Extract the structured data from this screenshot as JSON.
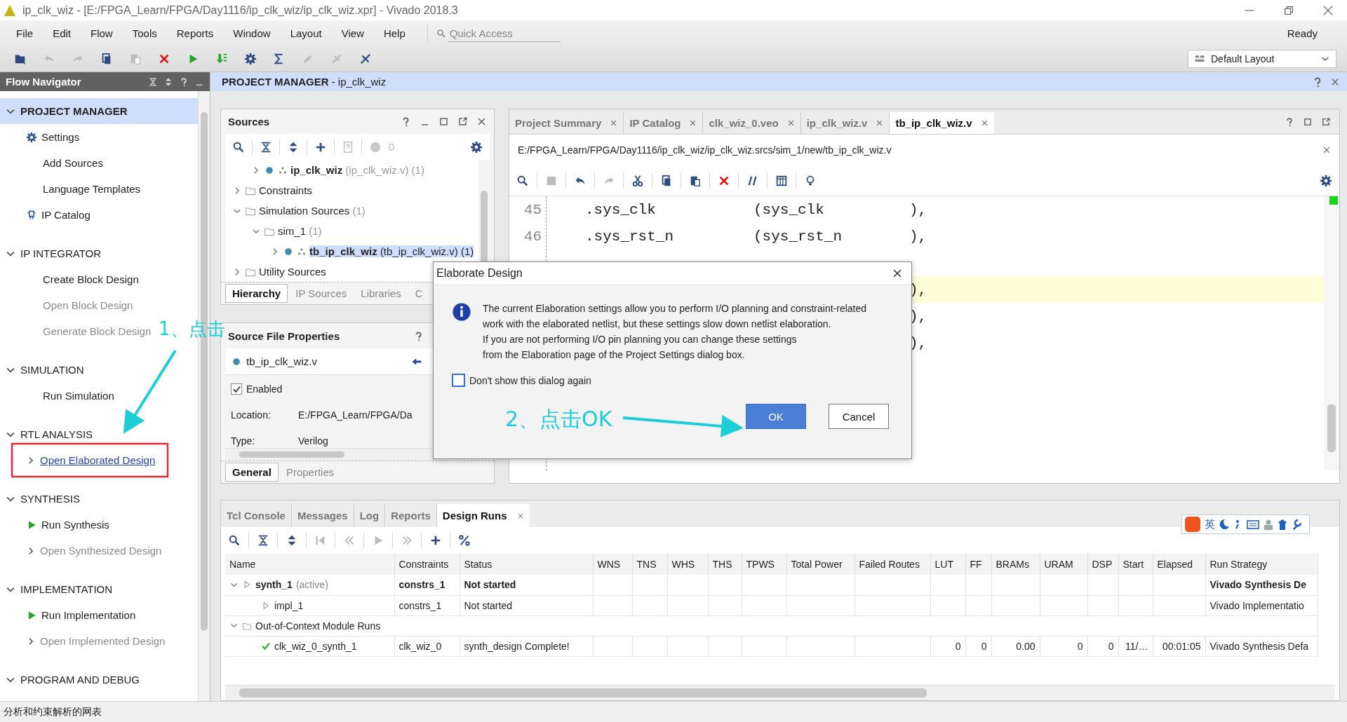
{
  "window": {
    "title": "ip_clk_wiz - [E:/FPGA_Learn/FPGA/Day1116/ip_clk_wiz/ip_clk_wiz.xpr] - Vivado 2018.3"
  },
  "menu": [
    "File",
    "Edit",
    "Flow",
    "Tools",
    "Reports",
    "Window",
    "Layout",
    "View",
    "Help"
  ],
  "quick_access": {
    "placeholder": "Quick Access"
  },
  "status": "Ready",
  "toolbar": [
    {
      "kind": "open",
      "disabled": false
    },
    {
      "kind": "undo",
      "disabled": true
    },
    {
      "kind": "redo",
      "disabled": true
    },
    {
      "kind": "copy",
      "disabled": false
    },
    {
      "kind": "paste",
      "disabled": true
    },
    {
      "kind": "delete",
      "disabled": false
    },
    {
      "kind": "run",
      "disabled": false
    },
    {
      "kind": "bitstream",
      "disabled": false
    },
    {
      "kind": "settings",
      "disabled": false
    },
    {
      "kind": "sigma",
      "disabled": false
    },
    {
      "kind": "pencil",
      "disabled": true
    },
    {
      "kind": "link",
      "disabled": true
    },
    {
      "kind": "tool",
      "disabled": false
    }
  ],
  "layout_selector": {
    "value": "Default Layout"
  },
  "flow_navigator": {
    "title": "Flow Navigator",
    "sections": [
      {
        "title": "PROJECT MANAGER",
        "expanded": true,
        "selected": true,
        "items": [
          {
            "label": "Settings",
            "kind": "settings",
            "disabled": false,
            "hovered": false
          },
          {
            "label": "Add Sources",
            "kind": "plain",
            "disabled": false,
            "hovered": false
          },
          {
            "label": "Language Templates",
            "kind": "plain",
            "disabled": false,
            "hovered": false
          },
          {
            "label": "IP Catalog",
            "kind": "ip",
            "disabled": false,
            "hovered": false
          }
        ]
      },
      {
        "title": "IP INTEGRATOR",
        "expanded": true,
        "selected": false,
        "items": [
          {
            "label": "Create Block Design",
            "kind": "plain",
            "disabled": false,
            "hovered": false
          },
          {
            "label": "Open Block Design",
            "kind": "plain",
            "disabled": true,
            "hovered": false
          },
          {
            "label": "Generate Block Design",
            "kind": "plain",
            "disabled": true,
            "hovered": false
          }
        ]
      },
      {
        "title": "SIMULATION",
        "expanded": true,
        "selected": false,
        "items": [
          {
            "label": "Run Simulation",
            "kind": "plain",
            "disabled": false,
            "hovered": false
          }
        ]
      },
      {
        "title": "RTL ANALYSIS",
        "expanded": true,
        "selected": false,
        "items": [
          {
            "label": "Open Elaborated Design",
            "kind": "expander",
            "disabled": false,
            "hovered": true
          }
        ]
      },
      {
        "title": "SYNTHESIS",
        "expanded": true,
        "selected": false,
        "items": [
          {
            "label": "Run Synthesis",
            "kind": "run",
            "disabled": false,
            "hovered": false
          },
          {
            "label": "Open Synthesized Design",
            "kind": "expander",
            "disabled": true,
            "hovered": false
          }
        ]
      },
      {
        "title": "IMPLEMENTATION",
        "expanded": true,
        "selected": false,
        "items": [
          {
            "label": "Run Implementation",
            "kind": "run",
            "disabled": false,
            "hovered": false
          },
          {
            "label": "Open Implemented Design",
            "kind": "expander",
            "disabled": true,
            "hovered": false
          }
        ]
      },
      {
        "title": "PROGRAM AND DEBUG",
        "expanded": true,
        "selected": false
      }
    ]
  },
  "project_header": "**PROJECT MANAGER** - ip_clk_wiz",
  "sources": {
    "title": "Sources",
    "warnings": "0",
    "tree": [
      {
        "children": [
          {
            "label": "ip_clk_wiz",
            "detail": "(ip_clk_wiz.v) (1)",
            "kind": "module",
            "expanded": false,
            "selected": false
          }
        ]
      },
      {
        "label": "Constraints",
        "kind": "folder",
        "expanded": false,
        "selected": false
      },
      {
        "label": "Simulation Sources",
        "detail": "(1)",
        "kind": "folder",
        "expanded": true,
        "selected": false,
        "children": [
          {
            "label": "sim_1",
            "detail": "(1)",
            "kind": "folder",
            "expanded": true,
            "selected": false,
            "children": [
              {
                "label": "tb_ip_clk_wiz",
                "detail": "(tb_ip_clk_wiz.v) (1)",
                "kind": "module",
                "expanded": false,
                "selected": true
              }
            ]
          }
        ]
      },
      {
        "label": "Utility Sources",
        "kind": "folder",
        "expanded": false,
        "selected": false
      }
    ],
    "tabs": [
      {
        "label": "Hierarchy",
        "selected": true
      },
      {
        "label": "IP Sources",
        "selected": false
      },
      {
        "label": "Libraries",
        "selected": false
      },
      {
        "label": "C",
        "selected": false
      }
    ]
  },
  "source_file_properties": {
    "title": "Source File Properties",
    "file": "tb_ip_clk_wiz.v",
    "enabled": {
      "label": "Enabled",
      "checked": true
    },
    "fields": [
      {
        "label": "Location:",
        "value": "E:/FPGA_Learn/FPGA/Da"
      },
      {
        "label": "Type:",
        "value": "Verilog"
      }
    ],
    "tabs": [
      {
        "label": "General",
        "selected": true
      },
      {
        "label": "Properties",
        "selected": false
      }
    ]
  },
  "editor": {
    "tabs": [
      {
        "label": "Project Summary",
        "selected": false
      },
      {
        "label": "IP Catalog",
        "selected": false
      },
      {
        "label": "clk_wiz_0.veo",
        "selected": false
      },
      {
        "label": "ip_clk_wiz.v",
        "selected": false
      },
      {
        "label": "tb_ip_clk_wiz.v",
        "selected": true
      }
    ],
    "path": "E:/FPGA_Learn/FPGA/Day1116/ip_clk_wiz/ip_clk_wiz.srcs/sim_1/new/tb_ip_clk_wiz.v",
    "toolbar": [
      {
        "kind": "search",
        "disabled": false
      },
      {
        "kind": "save",
        "disabled": true
      },
      {
        "kind": "undo",
        "disabled": false
      },
      {
        "kind": "redo",
        "disabled": true
      },
      {
        "kind": "cut",
        "disabled": false
      },
      {
        "kind": "copy",
        "disabled": false
      },
      {
        "kind": "paste",
        "disabled": false
      },
      {
        "kind": "delete",
        "disabled": false
      },
      {
        "kind": "comment",
        "disabled": false
      },
      {
        "kind": "columns",
        "disabled": false
      },
      {
        "kind": "bulb",
        "disabled": false
      }
    ],
    "lines": [
      {
        "number": "45",
        "port": ".sys_clk",
        "signal": "(sys_clk",
        "end": "),",
        "highlighted": false
      },
      {
        "number": "46",
        "port": ".sys_rst_n",
        "signal": "(sys_rst_n",
        "end": "),",
        "highlighted": false
      },
      {
        "end": "),",
        "highlighted": true
      },
      {
        "end": "),",
        "highlighted": false
      },
      {
        "end": "),",
        "highlighted": false
      }
    ]
  },
  "bottom_panel": {
    "tabs": [
      {
        "label": "Tcl Console",
        "selected": false
      },
      {
        "label": "Messages",
        "selected": false
      },
      {
        "label": "Log",
        "selected": false
      },
      {
        "label": "Reports",
        "selected": false
      },
      {
        "label": "Design Runs",
        "selected": true
      }
    ],
    "toolbar": [
      {
        "kind": "search",
        "disabled": false
      },
      {
        "kind": "collapse",
        "disabled": false
      },
      {
        "kind": "expand",
        "disabled": false
      },
      {
        "kind": "first",
        "disabled": true
      },
      {
        "kind": "rewind",
        "disabled": true
      },
      {
        "kind": "play",
        "disabled": true
      },
      {
        "kind": "forward",
        "disabled": true
      },
      {
        "kind": "add",
        "disabled": false
      },
      {
        "kind": "percent",
        "disabled": false
      }
    ],
    "columns": [
      "Name",
      "Constraints",
      "Status",
      "WNS",
      "TNS",
      "WHS",
      "THS",
      "TPWS",
      "Total Power",
      "Failed Routes",
      "LUT",
      "FF",
      "BRAMs",
      "URAM",
      "DSP",
      "Start",
      "Elapsed",
      "Run Strategy"
    ],
    "rows": [
      {
        "name": "synth_1",
        "note": "(active)",
        "kind": "run",
        "active": true,
        "expanded": true,
        "cells": [
          "constrs_1",
          "Not started",
          null,
          null,
          null,
          null,
          null,
          null,
          null,
          null,
          null,
          null,
          null,
          null,
          null,
          null,
          "Vivado Synthesis De"
        ],
        "children": [
          {
            "name": "impl_1",
            "kind": "run",
            "active": false,
            "cells": [
              "constrs_1",
              "Not started",
              null,
              null,
              null,
              null,
              null,
              null,
              null,
              null,
              null,
              null,
              null,
              null,
              null,
              null,
              "Vivado Implementatio"
            ]
          }
        ]
      },
      {
        "name": "Out-of-Context Module Runs",
        "kind": "folder",
        "active": false,
        "expanded": true,
        "children": [
          {
            "name": "clk_wiz_0_synth_1",
            "kind": "done",
            "active": false,
            "cells": [
              "clk_wiz_0",
              "synth_design Complete!",
              null,
              null,
              null,
              null,
              null,
              null,
              null,
              "0",
              "0",
              "0.00",
              "0",
              "0",
              "11/…",
              "00:01:05",
              "Vivado Synthesis Defa"
            ]
          }
        ]
      }
    ]
  },
  "dialog": {
    "title": "Elaborate Design",
    "message": "The current Elaboration settings allow you to perform I/O planning and constraint-related\nwork with the elaborated netlist, but these settings slow down netlist elaboration.\nIf you are not performing I/O pin planning you can change these settings\nfrom the Elaboration page of the Project Settings dialog box.",
    "dont_show": {
      "label": "Don't show this dialog again",
      "checked": false
    },
    "buttons": [
      {
        "label": "OK",
        "default": true
      },
      {
        "label": "Cancel",
        "default": false
      }
    ]
  },
  "ime_bar": {
    "mode": "英"
  },
  "annotations": [
    {
      "text": "1、点击"
    },
    {
      "text": "2、点击OK"
    }
  ],
  "status_bar": "分析和约束解析的网表"
}
